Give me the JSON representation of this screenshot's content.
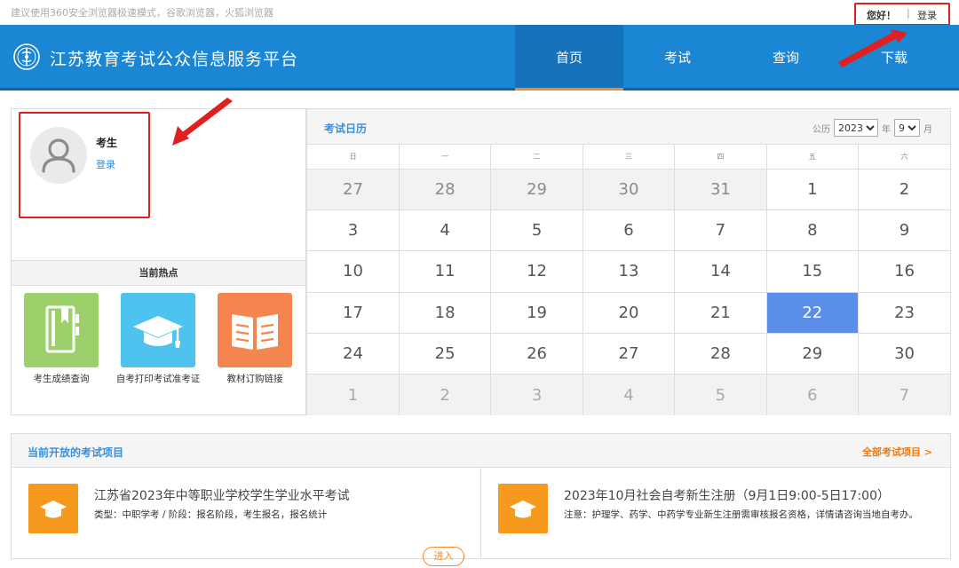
{
  "topbar": {
    "notice": "建议使用360安全浏览器极速模式，谷歌浏览器，火狐浏览器",
    "hello": "您好！",
    "separator": "|",
    "login": "登录"
  },
  "header": {
    "site_title": "江苏教育考试公众信息服务平台",
    "nav": [
      "首页",
      "考试",
      "查询",
      "下载"
    ],
    "active_nav": "首页"
  },
  "profile": {
    "name": "考生",
    "login": "登录"
  },
  "hot": {
    "title": "当前热点",
    "items": [
      {
        "label": "考生成绩查询",
        "icon": "notebook-icon",
        "color": "#9cd06a"
      },
      {
        "label": "自考打印考试准考证",
        "icon": "graduation-cap-icon",
        "color": "#4fc3f0"
      },
      {
        "label": "教材订购链接",
        "icon": "open-book-icon",
        "color": "#f5854f"
      }
    ]
  },
  "calendar": {
    "title": "考试日历",
    "calendar_label": "公历",
    "year": "2023",
    "year_unit": "年",
    "month": "9",
    "month_unit": "月",
    "weekdays": [
      "日",
      "一",
      "二",
      "三",
      "四",
      "五",
      "六"
    ],
    "weeks": [
      [
        {
          "d": "27",
          "t": "prev"
        },
        {
          "d": "28",
          "t": "prev"
        },
        {
          "d": "29",
          "t": "prev"
        },
        {
          "d": "30",
          "t": "prev"
        },
        {
          "d": "31",
          "t": "prev"
        },
        {
          "d": "1",
          "t": "cur"
        },
        {
          "d": "2",
          "t": "cur"
        }
      ],
      [
        {
          "d": "3",
          "t": "cur"
        },
        {
          "d": "4",
          "t": "cur"
        },
        {
          "d": "5",
          "t": "cur"
        },
        {
          "d": "6",
          "t": "cur"
        },
        {
          "d": "7",
          "t": "cur"
        },
        {
          "d": "8",
          "t": "cur"
        },
        {
          "d": "9",
          "t": "cur"
        }
      ],
      [
        {
          "d": "10",
          "t": "cur"
        },
        {
          "d": "11",
          "t": "cur"
        },
        {
          "d": "12",
          "t": "cur"
        },
        {
          "d": "13",
          "t": "cur"
        },
        {
          "d": "14",
          "t": "cur"
        },
        {
          "d": "15",
          "t": "cur"
        },
        {
          "d": "16",
          "t": "cur"
        }
      ],
      [
        {
          "d": "17",
          "t": "cur"
        },
        {
          "d": "18",
          "t": "cur"
        },
        {
          "d": "19",
          "t": "cur"
        },
        {
          "d": "20",
          "t": "cur"
        },
        {
          "d": "21",
          "t": "cur"
        },
        {
          "d": "22",
          "t": "today"
        },
        {
          "d": "23",
          "t": "cur"
        }
      ],
      [
        {
          "d": "24",
          "t": "cur"
        },
        {
          "d": "25",
          "t": "cur"
        },
        {
          "d": "26",
          "t": "cur"
        },
        {
          "d": "27",
          "t": "cur"
        },
        {
          "d": "28",
          "t": "cur"
        },
        {
          "d": "29",
          "t": "cur"
        },
        {
          "d": "30",
          "t": "cur"
        }
      ],
      [
        {
          "d": "1",
          "t": "next"
        },
        {
          "d": "2",
          "t": "next"
        },
        {
          "d": "3",
          "t": "next"
        },
        {
          "d": "4",
          "t": "next"
        },
        {
          "d": "5",
          "t": "next"
        },
        {
          "d": "6",
          "t": "next"
        },
        {
          "d": "7",
          "t": "next"
        }
      ]
    ]
  },
  "exams": {
    "title": "当前开放的考试项目",
    "all_link": "全部考试项目 >",
    "items": [
      {
        "name": "江苏省2023年中等职业学校学生学业水平考试",
        "meta": "类型：中职学考 / 阶段：报名阶段，考生报名，报名统计",
        "button": "进入",
        "icon": "graduation-cap-icon"
      },
      {
        "name": "2023年10月社会自考新生注册（9月1日9:00-5日17:00）",
        "meta": "注意：护理学、药学、中药学专业新生注册需审核报名资格，详情请咨询当地自考办。",
        "icon": "graduation-cap-icon"
      }
    ]
  },
  "colors": {
    "header_blue": "#1a86d4",
    "active_nav_blue": "#1672ba",
    "accent_orange": "#f08a2a",
    "today_blue": "#5b8ee8",
    "annotation_red": "#e02020"
  }
}
